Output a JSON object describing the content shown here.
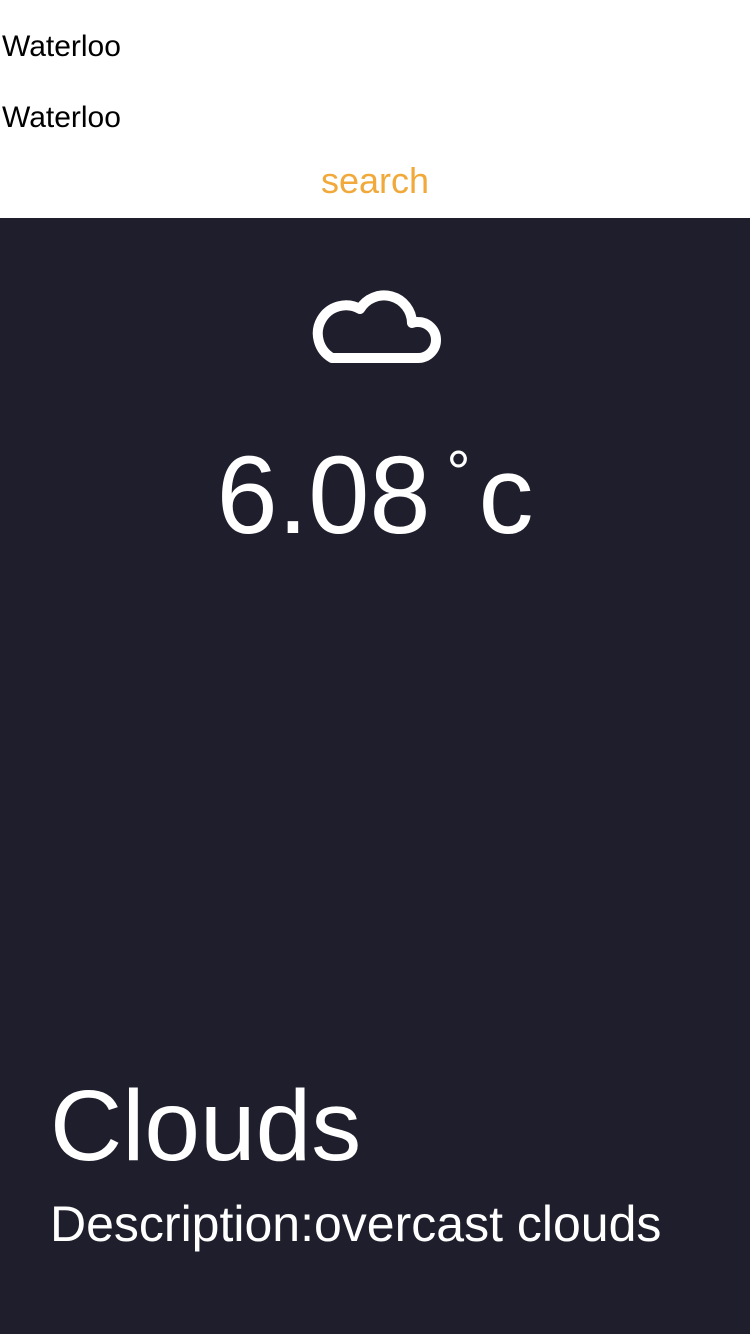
{
  "header": {
    "city_label": "Waterloo",
    "city_input_value": "Waterloo",
    "search_label": "search"
  },
  "weather": {
    "icon": "cloud-icon",
    "temperature": "6.08",
    "degree_symbol": "°",
    "unit": "c",
    "condition": "Clouds",
    "description": "Description:overcast clouds"
  },
  "colors": {
    "accent": "#f0a93a",
    "panel_background": "#1f1e2c",
    "text_on_panel": "#ffffff"
  }
}
